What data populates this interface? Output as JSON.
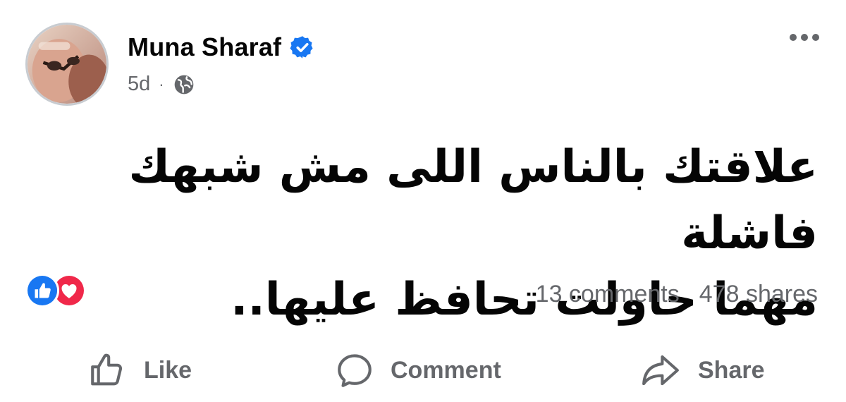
{
  "post": {
    "author": "Muna Sharaf",
    "timestamp": "5d",
    "separator": "·",
    "audience_icon": "globe-icon",
    "verified_icon": "verified-badge-icon",
    "text_lines": [
      "علاقتك بالناس اللى مش شبهك فاشلة",
      "مهما حاولت تحافظ عليها.."
    ]
  },
  "reactions": {
    "icons": [
      "like-reaction-icon",
      "love-reaction-icon"
    ],
    "comments": "13 comments",
    "shares": "478 shares"
  },
  "actions": {
    "like_label": "Like",
    "comment_label": "Comment",
    "share_label": "Share"
  },
  "colors": {
    "text": "#050505",
    "secondary": "#65676b",
    "verified": "#1877f2",
    "like": "#1877f2",
    "love": "#f0284a"
  }
}
